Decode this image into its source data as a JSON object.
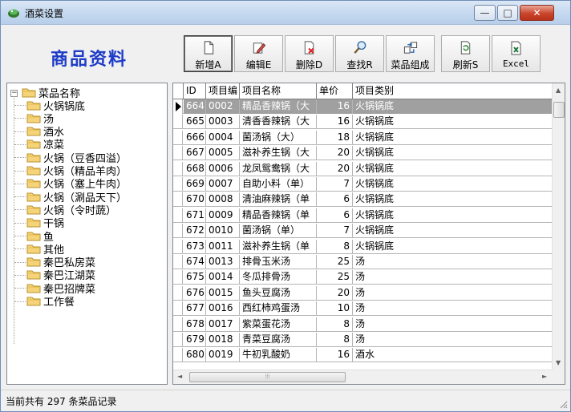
{
  "window": {
    "title": "酒菜设置",
    "min_glyph": "—",
    "max_glyph": "□",
    "close_glyph": "✕"
  },
  "header": {
    "page_title": "商品资料"
  },
  "toolbar": {
    "buttons": [
      {
        "id": "add",
        "label": "新增A",
        "icon": "new-document-icon"
      },
      {
        "id": "edit",
        "label": "编辑E",
        "icon": "edit-icon"
      },
      {
        "id": "delete",
        "label": "删除D",
        "icon": "delete-icon"
      },
      {
        "id": "find",
        "label": "查找R",
        "icon": "search-icon"
      },
      {
        "id": "compose",
        "label": "菜品组成",
        "icon": "compose-icon"
      },
      {
        "id": "refresh",
        "label": "刷新S",
        "icon": "refresh-icon"
      },
      {
        "id": "excel",
        "label": "Excel",
        "icon": "excel-icon"
      }
    ]
  },
  "tree": {
    "root": "菜品名称",
    "expander_glyph": "−",
    "items": [
      "火锅锅底",
      "汤",
      "酒水",
      "凉菜",
      "火锅（豆香四溢）",
      "火锅（精品羊肉）",
      "火锅（塞上牛肉）",
      "火锅（涮品天下）",
      "火锅（令时蔬）",
      "干锅",
      "鱼",
      "其他",
      "秦巴私房菜",
      "秦巴江湖菜",
      "秦巴招牌菜",
      "工作餐"
    ]
  },
  "grid": {
    "columns": [
      "ID",
      "项目编",
      "项目名称",
      "单价",
      "项目类别"
    ],
    "rows": [
      [
        "664",
        "0002",
        "精品香辣锅（大",
        "16",
        "火锅锅底"
      ],
      [
        "665",
        "0003",
        "清香香辣锅（大",
        "16",
        "火锅锅底"
      ],
      [
        "666",
        "0004",
        "菌汤锅（大）",
        "18",
        "火锅锅底"
      ],
      [
        "667",
        "0005",
        "滋补养生锅（大",
        "20",
        "火锅锅底"
      ],
      [
        "668",
        "0006",
        "龙凤鸳鸯锅（大",
        "20",
        "火锅锅底"
      ],
      [
        "669",
        "0007",
        "自助小料（单）",
        "7",
        "火锅锅底"
      ],
      [
        "670",
        "0008",
        "清油麻辣锅（单",
        "6",
        "火锅锅底"
      ],
      [
        "671",
        "0009",
        "精品香辣锅（单",
        "6",
        "火锅锅底"
      ],
      [
        "672",
        "0010",
        "菌汤锅（单）",
        "7",
        "火锅锅底"
      ],
      [
        "673",
        "0011",
        "滋补养生锅（单",
        "8",
        "火锅锅底"
      ],
      [
        "674",
        "0013",
        "排骨玉米汤",
        "25",
        "汤"
      ],
      [
        "675",
        "0014",
        "冬瓜排骨汤",
        "25",
        "汤"
      ],
      [
        "676",
        "0015",
        "鱼头豆腐汤",
        "20",
        "汤"
      ],
      [
        "677",
        "0016",
        "西红柿鸡蛋汤",
        "10",
        "汤"
      ],
      [
        "678",
        "0017",
        "紫菜蛋花汤",
        "8",
        "汤"
      ],
      [
        "679",
        "0018",
        "青菜豆腐汤",
        "8",
        "汤"
      ],
      [
        "680",
        "0019",
        "牛初乳酸奶",
        "16",
        "酒水"
      ]
    ],
    "selected_row": 0,
    "scroll": {
      "up": "▲",
      "down": "▼",
      "left": "◄",
      "right": "►",
      "thumb_grip": "⦙⦙⦙"
    }
  },
  "status": {
    "text": "当前共有 297 条菜品记录"
  },
  "colors": {
    "title_accent": "#1e3cc8",
    "selection": "#a0a0a0",
    "close_button": "#c9452c"
  }
}
